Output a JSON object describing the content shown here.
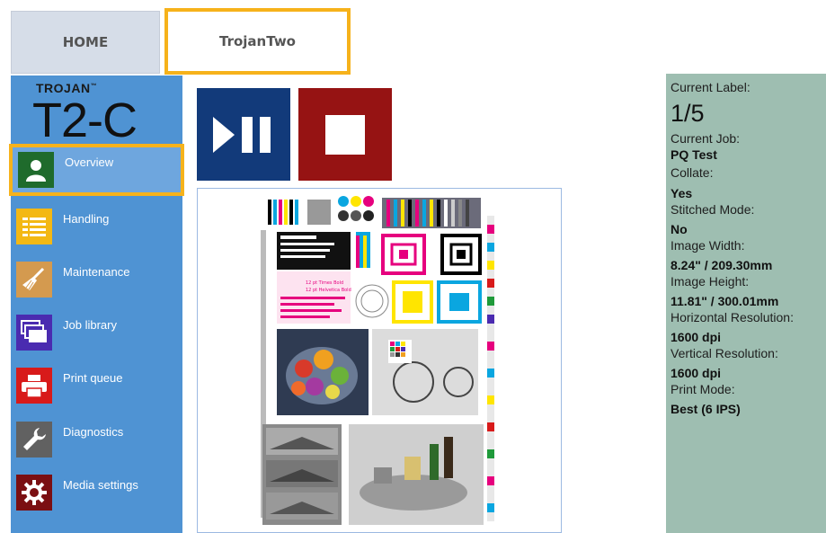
{
  "tabs": {
    "home": "HOME",
    "active": "TrojanTwo"
  },
  "brand": {
    "small": "TROJAN",
    "tm": "™",
    "model": "T2-C"
  },
  "sidebar": {
    "items": [
      {
        "label": "Overview",
        "icon": "user-icon",
        "color": "#1f6b2c",
        "selected": true
      },
      {
        "label": "Handling",
        "icon": "list-icon",
        "color": "#f3b814"
      },
      {
        "label": "Maintenance",
        "icon": "broom-icon",
        "color": "#d49a4f"
      },
      {
        "label": "Job library",
        "icon": "stacked-windows-icon",
        "color": "#4a2bb0"
      },
      {
        "label": "Print queue",
        "icon": "printer-icon",
        "color": "#d81a1a"
      },
      {
        "label": "Diagnostics",
        "icon": "wrench-icon",
        "color": "#616161"
      },
      {
        "label": "Media settings",
        "icon": "gear-icon",
        "color": "#7b0f12"
      }
    ]
  },
  "controls": {
    "play_pause": "play-pause-icon",
    "stop": "stop-icon"
  },
  "info": {
    "current_label_title": "Current Label:",
    "current_label_value": "1/5",
    "current_job_title": "Current Job:",
    "current_job_value": "PQ Test",
    "collate_title": "Collate:",
    "collate_value": "Yes",
    "stitched_title": "Stitched Mode:",
    "stitched_value": "No",
    "image_width_title": "Image Width:",
    "image_width_value": "8.24\" / 209.30mm",
    "image_height_title": "Image Height:",
    "image_height_value": "11.81\" / 300.01mm",
    "hres_title": "Horizontal Resolution:",
    "hres_value": "1600 dpi",
    "vres_title": "Vertical Resolution:",
    "vres_value": "1600 dpi",
    "print_mode_title": "Print Mode:",
    "print_mode_value": "Best (6 IPS)"
  },
  "preview": {
    "sample_text_1": "12 pt Times Bold",
    "sample_text_2": "12 pt Helvetica Bold"
  },
  "colors": {
    "sidebar": "#4f93d3",
    "highlight": "#f6b21b",
    "play_button": "#123a7a",
    "stop_button": "#961313",
    "info_panel": "#9ebeb1"
  }
}
